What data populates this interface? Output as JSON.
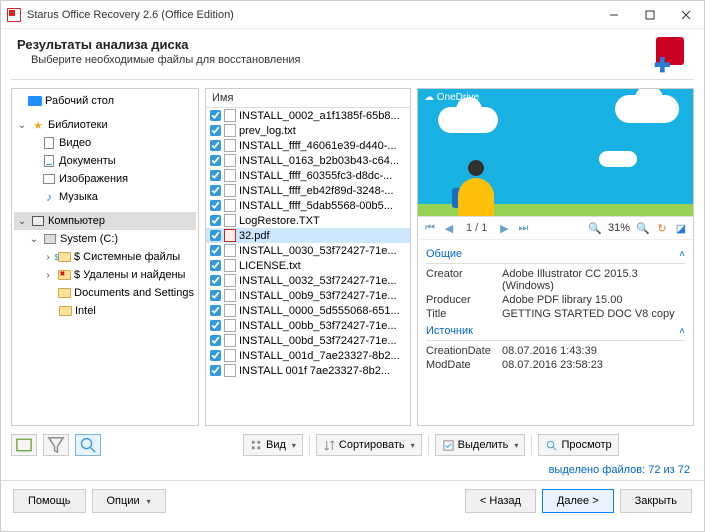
{
  "window": {
    "title": "Starus Office Recovery 2.6 (Office Edition)"
  },
  "header": {
    "title": "Результаты анализа диска",
    "subtitle": "Выберите необходимые файлы для восстановления"
  },
  "tree": {
    "desktop": "Рабочий стол",
    "libraries": "Библиотеки",
    "video": "Видео",
    "documents": "Документы",
    "images": "Изображения",
    "music": "Музыка",
    "computer": "Компьютер",
    "system_c": "System (C:)",
    "sys_files": "$ Системные файлы",
    "deleted": "$ Удалены и найдены",
    "docs_settings": "Documents and Settings",
    "intel": "Intel"
  },
  "list": {
    "header": "Имя",
    "files": [
      "INSTALL_0002_a1f1385f-65b8...",
      "prev_log.txt",
      "INSTALL_ffff_46061e39-d440-...",
      "INSTALL_0163_b2b03b43-c64...",
      "INSTALL_ffff_60355fc3-d8dc-...",
      "INSTALL_ffff_eb42f89d-3248-...",
      "INSTALL_ffff_5dab5568-00b5...",
      "LogRestore.TXT"
    ],
    "selected": "32.pdf",
    "files_after": [
      "INSTALL_0030_53f72427-71e...",
      "LICENSE.txt",
      "INSTALL_0032_53f72427-71e...",
      "INSTALL_00b9_53f72427-71e...",
      "INSTALL_0000_5d555068-651...",
      "INSTALL_00bb_53f72427-71e...",
      "INSTALL_00bd_53f72427-71e...",
      "INSTALL_001d_7ae23327-8b2...",
      "INSTALL  001f  7ae23327-8b2..."
    ]
  },
  "preview": {
    "brand": "☁ OneDrive",
    "page": "1 / 1",
    "zoom": "31%",
    "section_general": "Общие",
    "creator_k": "Creator",
    "creator_v": "Adobe Illustrator CC 2015.3 (Windows)",
    "producer_k": "Producer",
    "producer_v": "Adobe PDF library 15.00",
    "title_k": "Title",
    "title_v": "GETTING STARTED DOC V8 copy",
    "section_source": "Источник",
    "cdate_k": "CreationDate",
    "cdate_v": "08.07.2016 1:43:39",
    "mdate_k": "ModDate",
    "mdate_v": "08.07.2016 23:58:23"
  },
  "toolbar": {
    "view": "Вид",
    "sort": "Сортировать",
    "select": "Выделить",
    "preview": "Просмотр"
  },
  "status": {
    "label": "выделено файлов:",
    "count": "72 из 72"
  },
  "footer": {
    "help": "Помощь",
    "options": "Опции",
    "back": "< Назад",
    "next": "Далее >",
    "close": "Закрыть"
  }
}
